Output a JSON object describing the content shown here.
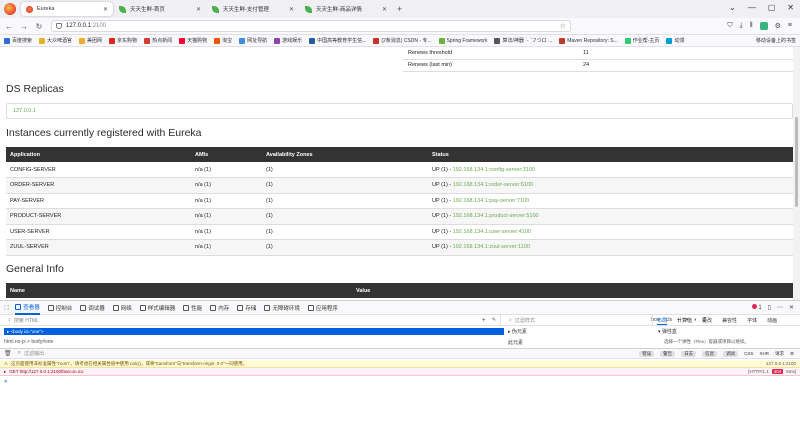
{
  "browser": {
    "tabs": [
      {
        "title": "Eureka",
        "active": true,
        "icon": "eureka"
      },
      {
        "title": "天天生鲜-首页",
        "active": false,
        "icon": "leaf"
      },
      {
        "title": "天天生鲜-支付管理",
        "active": false,
        "icon": "leaf"
      },
      {
        "title": "天天生鲜-商品详情",
        "active": false,
        "icon": "leaf"
      }
    ],
    "url_host": "127.0.0.1",
    "url_port": ":2100",
    "bookmarks": [
      "百度搜索",
      "大众啤酒官",
      "美团网",
      "京东购物",
      "热点新闻",
      "天猫购物",
      "淘宝",
      "网址导航",
      "游戏娱乐",
      "中国高等教育学生信...",
      "(2条消息) CSDN - 专...",
      "Spring Framework",
      "算法/神器 `- `フつロ ...",
      "Maven Repository: S...",
      "作业帮-主页",
      "动漫"
    ],
    "bookmarks_right": "移动设备上的书签"
  },
  "eureka": {
    "renews": [
      {
        "label": "Renews threshold",
        "value": "11"
      },
      {
        "label": "Renews (last min)",
        "value": "24"
      }
    ],
    "ds_replicas_title": "DS Replicas",
    "replica": "127.0.0.1",
    "instances_title": "Instances currently registered with Eureka",
    "instance_headers": [
      "Application",
      "AMIs",
      "Availability Zones",
      "Status"
    ],
    "instances": [
      {
        "app": "CONFIG-SERVER",
        "amis": "n/a (1)",
        "zones": "(1)",
        "status": "UP (1) - ",
        "link": "192.168.134.1:config-server:3100"
      },
      {
        "app": "ORDER-SERVER",
        "amis": "n/a (1)",
        "zones": "(1)",
        "status": "UP (1) - ",
        "link": "192.168.134.1:order-server:6100"
      },
      {
        "app": "PAY-SERVER",
        "amis": "n/a (1)",
        "zones": "(1)",
        "status": "UP (1) - ",
        "link": "192.168.134.1:pay-server:7100"
      },
      {
        "app": "PRODUCT-SERVER",
        "amis": "n/a (1)",
        "zones": "(1)",
        "status": "UP (1) - ",
        "link": "192.168.134.1:product-server:5100"
      },
      {
        "app": "USER-SERVER",
        "amis": "n/a (1)",
        "zones": "(1)",
        "status": "UP (1) - ",
        "link": "192.168.134.1:user-server:4100"
      },
      {
        "app": "ZUUL-SERVER",
        "amis": "n/a (1)",
        "zones": "(1)",
        "status": "UP (1) - ",
        "link": "192.168.134.1:zuul-server:1100"
      }
    ],
    "general_title": "General Info",
    "general_headers": [
      "Name",
      "Value"
    ]
  },
  "devtools": {
    "tabs": [
      "查看器",
      "控制台",
      "调试器",
      "网络",
      "样式编辑器",
      "性能",
      "内存",
      "存储",
      "无障碍环境",
      "应用程序"
    ],
    "error_count": "1",
    "search_html_placeholder": "搜索 HTML",
    "filter_styles_placeholder": "过滤样式",
    "style_buttons": [
      ":hov",
      ".cls"
    ],
    "layout_tabs": [
      "布局",
      "计算值",
      "更改",
      "兼容性",
      "字体",
      "动画"
    ],
    "selected_node": "<body id=\"one\">",
    "breadcrumb": "html.no-js > body#one",
    "pseudo_label": "伪元素",
    "this_element_label": "此元素",
    "flexbox_label": "弹性盒",
    "flexbox_msg": "选择一个弹性（Flex）容器或项目以继续。",
    "console_filter_placeholder": "过滤输出",
    "console_filters": [
      "错误",
      "警告",
      "日志",
      "信息",
      "调试",
      "CSS",
      "XHR",
      "请求"
    ],
    "warning_text": "这页面使用非标准属性\"zoom\"。请考虑在相关属性值中使用 calc()，或将\"transform\"与\"transform-origin: 0 0\"一同使用。",
    "warning_source": "127.0.0.1:2100",
    "error_text": "GET http://127.0.0.1:2100/favicon.ico",
    "error_proto": "[HTTP/1.1",
    "error_status": "404",
    "error_time": "6ms]"
  }
}
